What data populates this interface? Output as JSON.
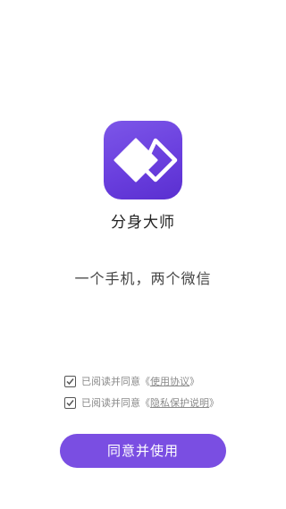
{
  "app": {
    "logo_icon": "double-diamond-icon",
    "name": "分身大师",
    "slogan": "一个手机，两个微信"
  },
  "agreements": [
    {
      "checked": true,
      "prefix": "已阅读并同意",
      "open": "《",
      "link": "使用协议",
      "close": "》"
    },
    {
      "checked": true,
      "prefix": "已阅读并同意",
      "open": "《",
      "link": "隐私保护说明",
      "close": "》"
    }
  ],
  "primary_button": {
    "label": "同意并使用"
  },
  "colors": {
    "brand": "#6a3fde",
    "button": "#7a4ee2",
    "text_muted": "#8a8a8a"
  }
}
